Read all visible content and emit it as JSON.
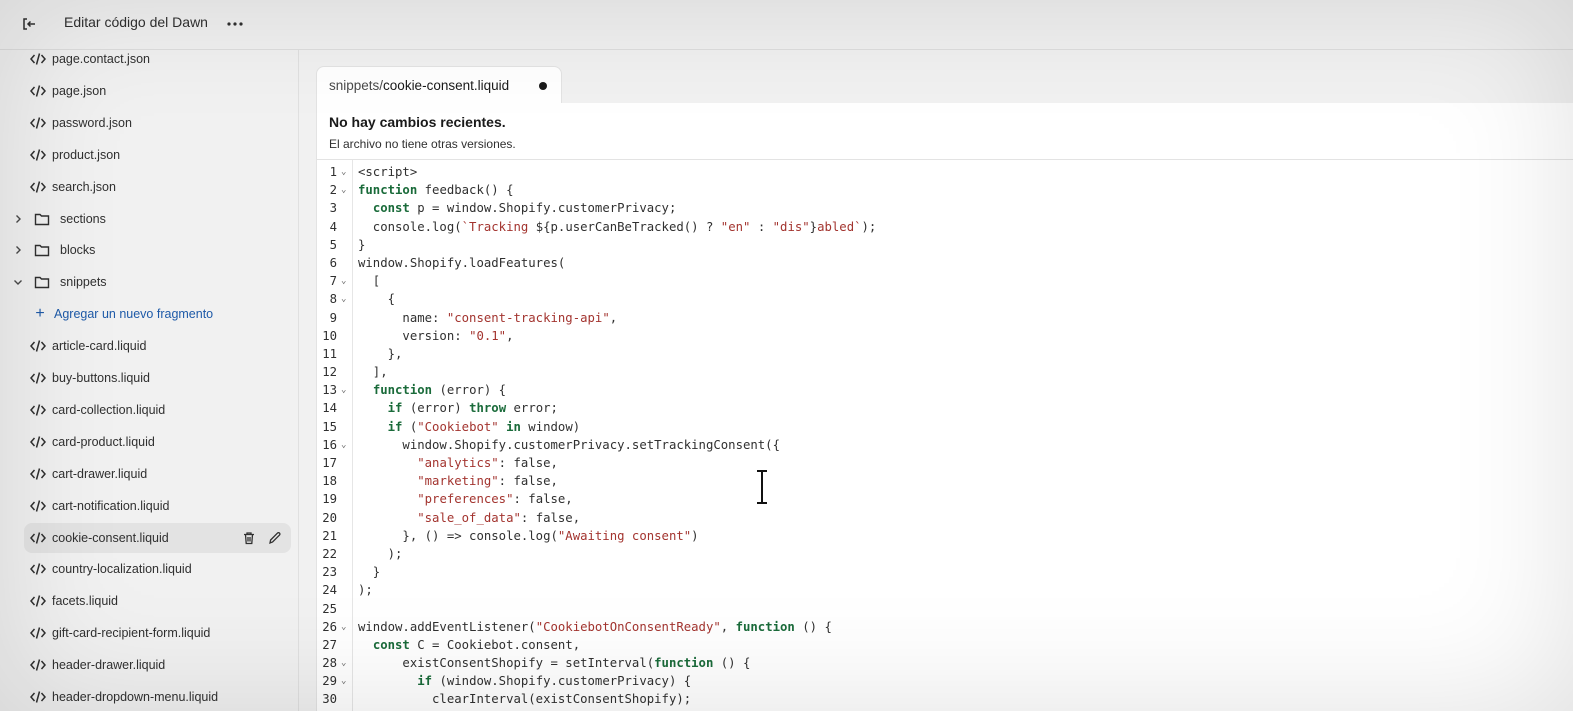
{
  "topbar": {
    "title": "Editar código del Dawn",
    "exit_icon": "exit-icon",
    "more_icon": "ellipsis-icon"
  },
  "sidebar": {
    "files_top": [
      {
        "label": "page.contact.json"
      },
      {
        "label": "page.json"
      },
      {
        "label": "password.json"
      },
      {
        "label": "product.json"
      },
      {
        "label": "search.json"
      }
    ],
    "folders": [
      {
        "label": "sections",
        "expanded": false
      },
      {
        "label": "blocks",
        "expanded": false
      },
      {
        "label": "snippets",
        "expanded": true
      }
    ],
    "add_snippet_label": "Agregar un nuevo fragmento",
    "snippets": [
      {
        "label": "article-card.liquid"
      },
      {
        "label": "buy-buttons.liquid"
      },
      {
        "label": "card-collection.liquid"
      },
      {
        "label": "card-product.liquid"
      },
      {
        "label": "cart-drawer.liquid"
      },
      {
        "label": "cart-notification.liquid"
      },
      {
        "label": "cookie-consent.liquid",
        "active": true
      },
      {
        "label": "country-localization.liquid"
      },
      {
        "label": "facets.liquid"
      },
      {
        "label": "gift-card-recipient-form.liquid"
      },
      {
        "label": "header-drawer.liquid"
      },
      {
        "label": "header-dropdown-menu.liquid"
      }
    ]
  },
  "tab": {
    "dir": "snippets/",
    "filename": "cookie-consent.liquid",
    "unsaved": true
  },
  "notice": {
    "title": "No hay cambios recientes.",
    "subtitle": "El archivo no tiene otras versiones."
  },
  "code": {
    "lines": [
      {
        "n": "1",
        "fold": true,
        "tokens": [
          [
            "t",
            "<script>"
          ]
        ]
      },
      {
        "n": "2",
        "fold": true,
        "tokens": [
          [
            "k",
            "function"
          ],
          [
            "t",
            " feedback() {"
          ]
        ]
      },
      {
        "n": "3",
        "fold": false,
        "tokens": [
          [
            "t",
            "  "
          ],
          [
            "k",
            "const"
          ],
          [
            "t",
            " p = window.Shopify.customerPrivacy;"
          ]
        ]
      },
      {
        "n": "4",
        "fold": false,
        "tokens": [
          [
            "t",
            "  console.log("
          ],
          [
            "s",
            "`Tracking "
          ],
          [
            "t",
            "${p.userCanBeTracked() ? "
          ],
          [
            "s",
            "\"en\""
          ],
          [
            "t",
            " : "
          ],
          [
            "s",
            "\"dis\""
          ],
          [
            "t",
            "}"
          ],
          [
            "s",
            "abled`"
          ],
          [
            "t",
            ");"
          ]
        ]
      },
      {
        "n": "5",
        "fold": false,
        "tokens": [
          [
            "t",
            "}"
          ]
        ]
      },
      {
        "n": "6",
        "fold": false,
        "tokens": [
          [
            "t",
            "window.Shopify.loadFeatures("
          ]
        ]
      },
      {
        "n": "7",
        "fold": true,
        "tokens": [
          [
            "t",
            "  ["
          ]
        ]
      },
      {
        "n": "8",
        "fold": true,
        "tokens": [
          [
            "t",
            "    {"
          ]
        ]
      },
      {
        "n": "9",
        "fold": false,
        "tokens": [
          [
            "t",
            "      name: "
          ],
          [
            "s",
            "\"consent-tracking-api\""
          ],
          [
            "t",
            ","
          ]
        ]
      },
      {
        "n": "10",
        "fold": false,
        "tokens": [
          [
            "t",
            "      version: "
          ],
          [
            "s",
            "\"0.1\""
          ],
          [
            "t",
            ","
          ]
        ]
      },
      {
        "n": "11",
        "fold": false,
        "tokens": [
          [
            "t",
            "    },"
          ]
        ]
      },
      {
        "n": "12",
        "fold": false,
        "tokens": [
          [
            "t",
            "  ],"
          ]
        ]
      },
      {
        "n": "13",
        "fold": true,
        "tokens": [
          [
            "t",
            "  "
          ],
          [
            "k",
            "function"
          ],
          [
            "t",
            " (error) {"
          ]
        ]
      },
      {
        "n": "14",
        "fold": false,
        "tokens": [
          [
            "t",
            "    "
          ],
          [
            "k",
            "if"
          ],
          [
            "t",
            " (error) "
          ],
          [
            "k",
            "throw"
          ],
          [
            "t",
            " error;"
          ]
        ]
      },
      {
        "n": "15",
        "fold": false,
        "tokens": [
          [
            "t",
            "    "
          ],
          [
            "k",
            "if"
          ],
          [
            "t",
            " ("
          ],
          [
            "s",
            "\"Cookiebot\""
          ],
          [
            "t",
            " "
          ],
          [
            "k",
            "in"
          ],
          [
            "t",
            " window)"
          ]
        ]
      },
      {
        "n": "16",
        "fold": true,
        "tokens": [
          [
            "t",
            "      window.Shopify.customerPrivacy.setTrackingConsent({"
          ]
        ]
      },
      {
        "n": "17",
        "fold": false,
        "tokens": [
          [
            "t",
            "        "
          ],
          [
            "s",
            "\"analytics\""
          ],
          [
            "t",
            ": false,"
          ]
        ]
      },
      {
        "n": "18",
        "fold": false,
        "tokens": [
          [
            "t",
            "        "
          ],
          [
            "s",
            "\"marketing\""
          ],
          [
            "t",
            ": false,"
          ]
        ]
      },
      {
        "n": "19",
        "fold": false,
        "tokens": [
          [
            "t",
            "        "
          ],
          [
            "s",
            "\"preferences\""
          ],
          [
            "t",
            ": false,"
          ]
        ]
      },
      {
        "n": "20",
        "fold": false,
        "tokens": [
          [
            "t",
            "        "
          ],
          [
            "s",
            "\"sale_of_data\""
          ],
          [
            "t",
            ": false,"
          ]
        ]
      },
      {
        "n": "21",
        "fold": false,
        "tokens": [
          [
            "t",
            "      }, () => console.log("
          ],
          [
            "s",
            "\"Awaiting consent\""
          ],
          [
            "t",
            ")"
          ]
        ]
      },
      {
        "n": "22",
        "fold": false,
        "tokens": [
          [
            "t",
            "    );"
          ]
        ]
      },
      {
        "n": "23",
        "fold": false,
        "tokens": [
          [
            "t",
            "  }"
          ]
        ]
      },
      {
        "n": "24",
        "fold": false,
        "tokens": [
          [
            "t",
            ");"
          ]
        ]
      },
      {
        "n": "25",
        "fold": false,
        "tokens": [
          [
            "t",
            ""
          ]
        ]
      },
      {
        "n": "26",
        "fold": true,
        "tokens": [
          [
            "t",
            "window.addEventListener("
          ],
          [
            "s",
            "\"CookiebotOnConsentReady\""
          ],
          [
            "t",
            ", "
          ],
          [
            "k",
            "function"
          ],
          [
            "t",
            " () {"
          ]
        ]
      },
      {
        "n": "27",
        "fold": false,
        "tokens": [
          [
            "t",
            "  "
          ],
          [
            "k",
            "const"
          ],
          [
            "t",
            " C = Cookiebot.consent,"
          ]
        ]
      },
      {
        "n": "28",
        "fold": true,
        "tokens": [
          [
            "t",
            "      existConsentShopify = setInterval("
          ],
          [
            "k",
            "function"
          ],
          [
            "t",
            " () {"
          ]
        ]
      },
      {
        "n": "29",
        "fold": true,
        "tokens": [
          [
            "t",
            "        "
          ],
          [
            "k",
            "if"
          ],
          [
            "t",
            " (window.Shopify.customerPrivacy) {"
          ]
        ]
      },
      {
        "n": "30",
        "fold": false,
        "tokens": [
          [
            "t",
            "          clearInterval(existConsentShopify);"
          ]
        ]
      }
    ]
  }
}
